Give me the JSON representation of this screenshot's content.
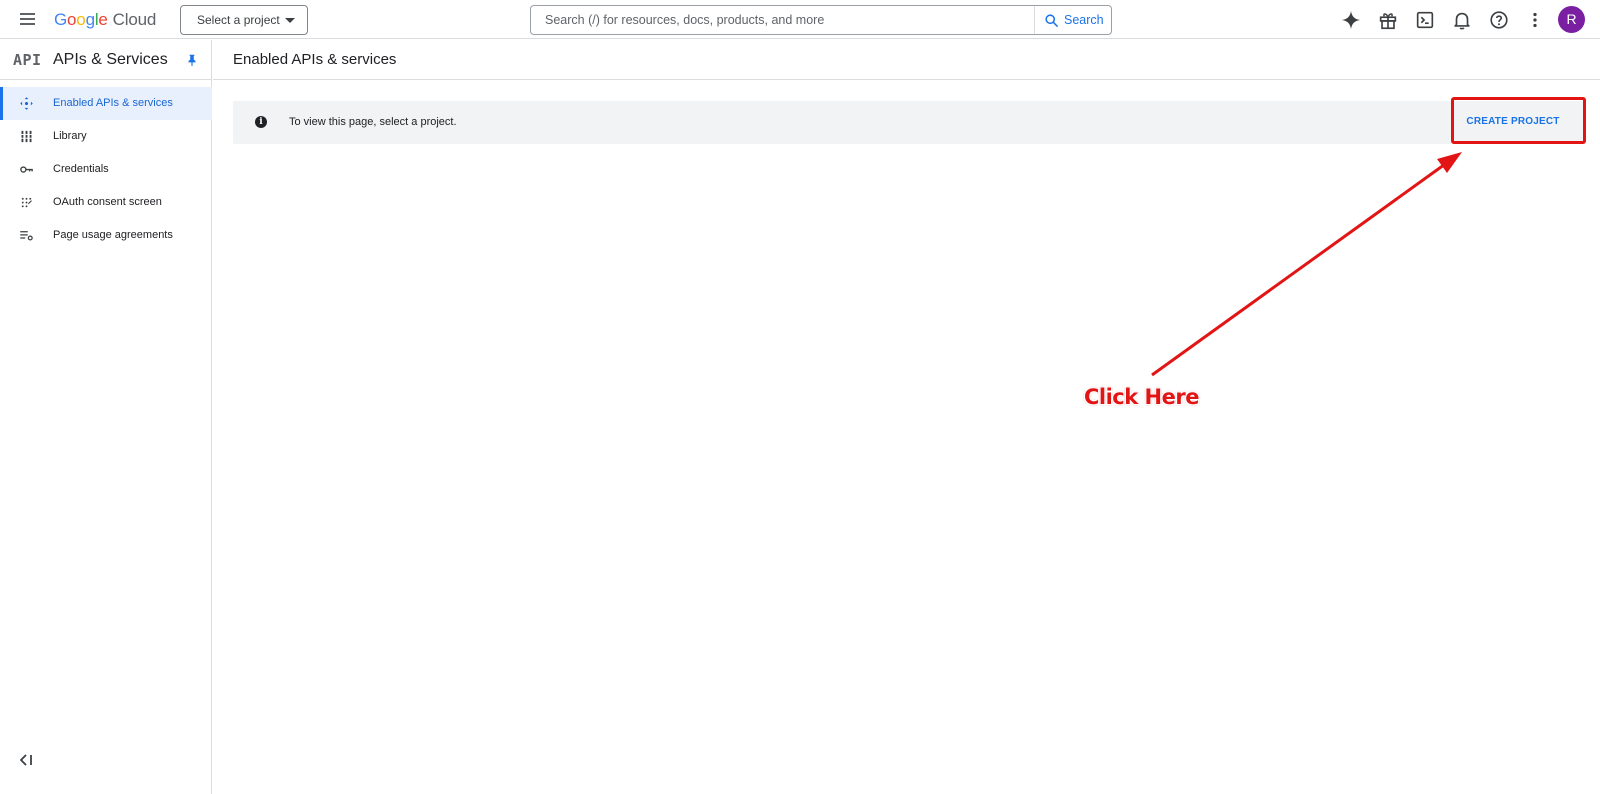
{
  "header": {
    "logo_google": [
      "G",
      "o",
      "o",
      "g",
      "l",
      "e"
    ],
    "logo_product": "Cloud",
    "project_selector": "Select a project",
    "search": {
      "placeholder": "Search (/) for resources, docs, products, and more",
      "button_label": "Search"
    },
    "icons": [
      "gemini-sparkle-icon",
      "gift-icon",
      "cloud-shell-icon",
      "notifications-bell-icon",
      "help-icon",
      "more-vert-icon"
    ],
    "avatar_initial": "R",
    "avatar_color": "#7b1fa2"
  },
  "sidebar": {
    "badge": "API",
    "title": "APIs & Services",
    "items": [
      {
        "label": "Enabled APIs & services",
        "icon": "enabled-apis-icon",
        "active": true
      },
      {
        "label": "Library",
        "icon": "library-icon",
        "active": false
      },
      {
        "label": "Credentials",
        "icon": "key-icon",
        "active": false
      },
      {
        "label": "OAuth consent screen",
        "icon": "oauth-icon",
        "active": false
      },
      {
        "label": "Page usage agreements",
        "icon": "settings-list-icon",
        "active": false
      }
    ],
    "collapse_icon": "collapse-sidebar-icon"
  },
  "main": {
    "page_title": "Enabled APIs & services",
    "banner": {
      "message": "To view this page, select a project.",
      "info_glyph": "i",
      "action_label": "CREATE PROJECT"
    }
  },
  "annotation": {
    "callout_text": "Click Here",
    "color": "#e31414"
  },
  "colors": {
    "accent": "#1a73e8",
    "active_bg": "#e8f0fe",
    "banner_bg": "#f1f3f4"
  }
}
